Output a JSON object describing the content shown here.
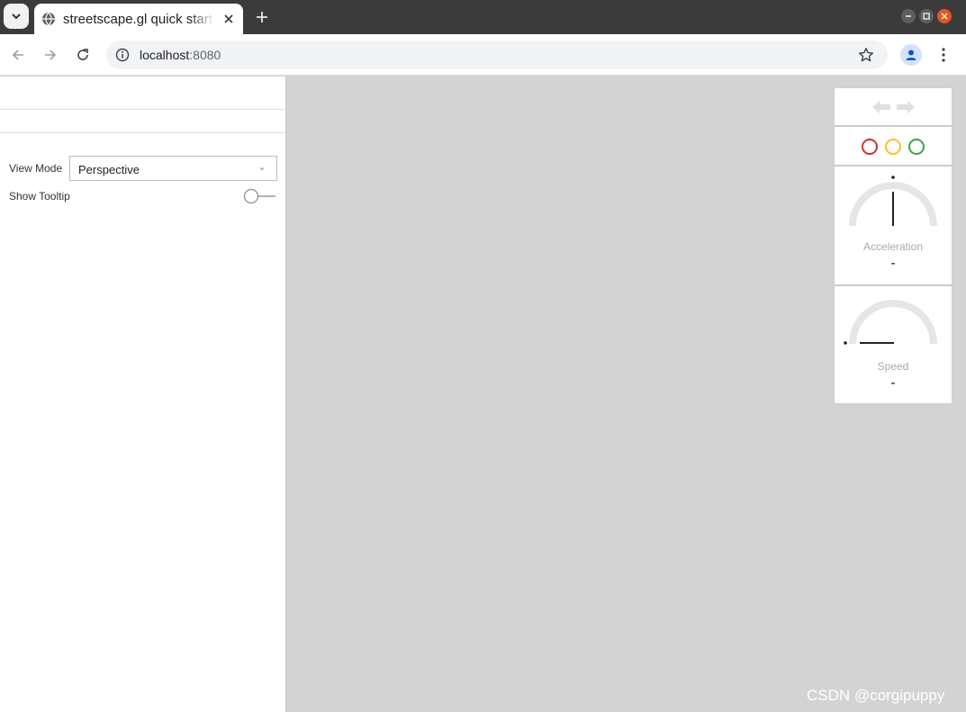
{
  "browser": {
    "tab_title": "streetscape.gl quick start",
    "url_host": "localhost",
    "url_port": ":8080"
  },
  "sidebar": {
    "view_mode_label": "View Mode",
    "view_mode_value": "Perspective",
    "show_tooltip_label": "Show Tooltip",
    "show_tooltip_on": false
  },
  "meters": {
    "lights": {
      "red": "#d32f2f",
      "yellow": "#fbc02d",
      "green": "#43a047"
    },
    "acceleration": {
      "label": "Acceleration",
      "value": "-"
    },
    "speed": {
      "label": "Speed",
      "value": "-"
    }
  },
  "watermark": "CSDN @corgipuppy"
}
